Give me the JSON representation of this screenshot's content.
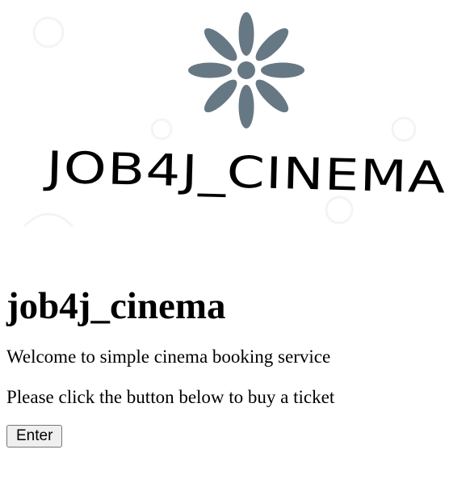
{
  "logo": {
    "text": "JOB4J_CINEMA",
    "icon": "flower-petals-icon",
    "icon_color": "#667884"
  },
  "page": {
    "heading": "job4j_cinema",
    "welcome_text": "Welcome to simple cinema booking service",
    "instruction_text": "Please click the button below to buy a ticket",
    "enter_button_label": "Enter"
  },
  "colors": {
    "background": "#ffffff",
    "text": "#000000",
    "button_bg": "#efefef",
    "button_border": "#767676"
  }
}
